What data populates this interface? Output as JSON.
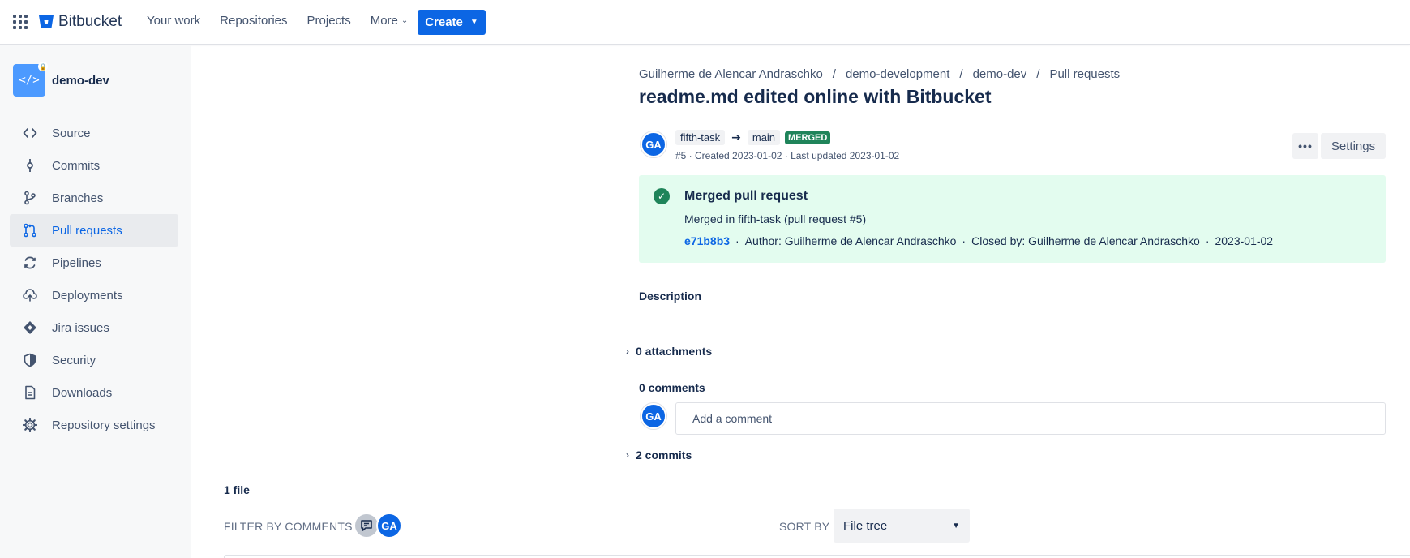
{
  "topbar": {
    "product_name": "Bitbucket",
    "nav": [
      "Your work",
      "Repositories",
      "Projects",
      "More"
    ],
    "create_label": "Create"
  },
  "sidebar": {
    "repo_name": "demo-dev",
    "items": [
      {
        "label": "Source",
        "icon": "source-icon"
      },
      {
        "label": "Commits",
        "icon": "commits-icon"
      },
      {
        "label": "Branches",
        "icon": "branches-icon"
      },
      {
        "label": "Pull requests",
        "icon": "pull-requests-icon",
        "active": true
      },
      {
        "label": "Pipelines",
        "icon": "pipelines-icon"
      },
      {
        "label": "Deployments",
        "icon": "deployments-icon"
      },
      {
        "label": "Jira issues",
        "icon": "jira-icon"
      },
      {
        "label": "Security",
        "icon": "shield-icon"
      },
      {
        "label": "Downloads",
        "icon": "document-icon"
      },
      {
        "label": "Repository settings",
        "icon": "gear-icon"
      }
    ]
  },
  "breadcrumb": [
    "Guilherme de Alencar Andraschko",
    "demo-development",
    "demo-dev",
    "Pull requests"
  ],
  "pr": {
    "title": "readme.md edited online with Bitbucket",
    "author_initials": "GA",
    "source_branch": "fifth-task",
    "target_branch": "main",
    "status": "MERGED",
    "meta": "#5 · Created 2023-01-02 · Last updated 2023-01-02",
    "settings_label": "Settings",
    "more_label": "•••"
  },
  "merged": {
    "title": "Merged pull request",
    "description": "Merged in fifth-task (pull request #5)",
    "commit_hash": "e71b8b3",
    "author": "Author: Guilherme de Alencar Andraschko",
    "closed_by": "Closed by: Guilherme de Alencar Andraschko",
    "date": "2023-01-02"
  },
  "description_label": "Description",
  "attachments_label": "0 attachments",
  "comments_label": "0 comments",
  "comment_placeholder": "Add a comment",
  "commits_label": "2 commits",
  "files": {
    "count_label": "1 file",
    "filter_label": "FILTER BY COMMENTS",
    "sort_label": "SORT BY",
    "sort_value": "File tree"
  },
  "colors": {
    "brand": "#0c66e4",
    "merged": "#1f845a",
    "merged_bg": "#e3fcef"
  }
}
